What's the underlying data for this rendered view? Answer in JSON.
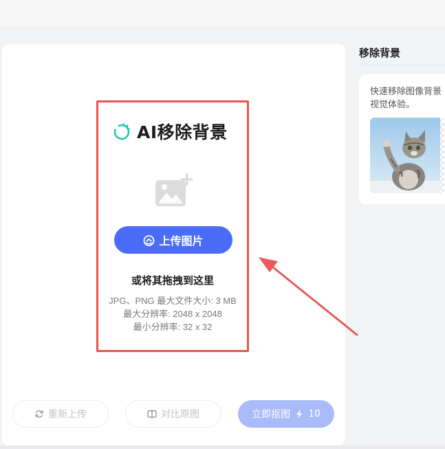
{
  "brand": {
    "title": "AI移除背景",
    "logo_icon": "ring-logo-icon",
    "accent_color": "#26c6b0"
  },
  "upload": {
    "placeholder_icon": "image-add-icon",
    "button_label": "上传图片",
    "button_icon": "upload-cloud-icon",
    "button_color": "#4a6cf7",
    "drag_text": "或将其拖拽到这里",
    "info": {
      "formats": "JPG、PNG 最大文件大小: 3 MB",
      "max_resolution": "最大分辨率: 2048 x 2048",
      "min_resolution": "最小分辨率: 32 x 32"
    },
    "highlight_color": "#e8534f"
  },
  "actions": {
    "reupload_label": "重新上传",
    "reupload_icon": "refresh-icon",
    "compare_label": "对比原图",
    "compare_icon": "split-view-icon",
    "cutout_label": "立即抠图",
    "cutout_icon": "lightning-icon",
    "cutout_cost": "10"
  },
  "sidebar": {
    "title": "移除背景",
    "description_line1": "快速移除图像背景",
    "description_line2": "视觉体验。",
    "preview_image": "cat-preview"
  }
}
